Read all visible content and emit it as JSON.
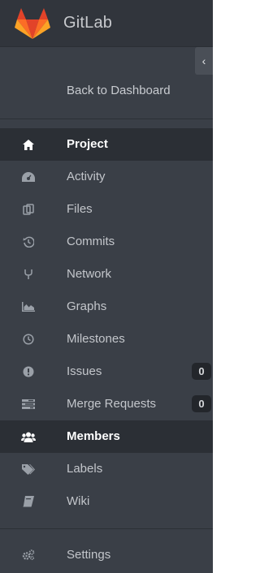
{
  "brand": {
    "title": "GitLab",
    "logo_icon": "gitlab-fox-logo",
    "logo_colors": [
      "#e24329",
      "#fc6d26",
      "#fca326"
    ]
  },
  "collapse_toggle": {
    "icon": "chevron-left-icon",
    "glyph": "‹"
  },
  "back_link": {
    "label": "Back to Dashboard"
  },
  "nav": {
    "items": [
      {
        "label": "Project",
        "icon": "home-icon",
        "active": true
      },
      {
        "label": "Activity",
        "icon": "dashboard-icon",
        "active": false
      },
      {
        "label": "Files",
        "icon": "files-icon",
        "active": false
      },
      {
        "label": "Commits",
        "icon": "history-icon",
        "active": false
      },
      {
        "label": "Network",
        "icon": "code-fork-icon",
        "active": false
      },
      {
        "label": "Graphs",
        "icon": "area-chart-icon",
        "active": false
      },
      {
        "label": "Milestones",
        "icon": "clock-icon",
        "active": false
      },
      {
        "label": "Issues",
        "icon": "exclamation-circle-icon",
        "active": false,
        "badge": "0"
      },
      {
        "label": "Merge Requests",
        "icon": "tasks-icon",
        "active": false,
        "badge": "0"
      },
      {
        "label": "Members",
        "icon": "users-icon",
        "active": true
      },
      {
        "label": "Labels",
        "icon": "tags-icon",
        "active": false
      },
      {
        "label": "Wiki",
        "icon": "book-icon",
        "active": false
      }
    ]
  },
  "settings": {
    "label": "Settings",
    "icon": "cogs-icon"
  },
  "colors": {
    "sidebar_bg": "#3a3f47",
    "active_bg": "#2b2f35",
    "text": "#c3c6cb",
    "active_text": "#ffffff"
  }
}
